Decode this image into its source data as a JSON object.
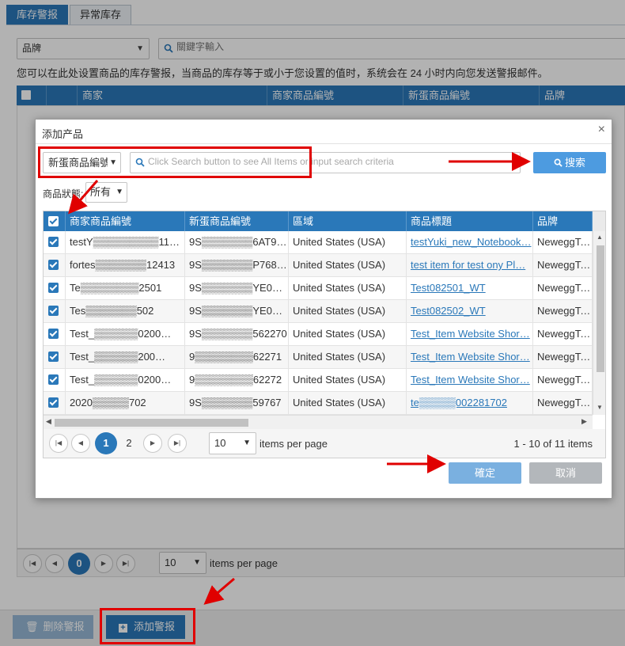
{
  "tabs": [
    {
      "label": "库存警报"
    },
    {
      "label": "异常库存"
    }
  ],
  "filter": {
    "field_value": "品牌",
    "search_placeholder": "關鍵字輸入"
  },
  "description": "您可以在此处设置商品的库存警报，当商品的库存等于或小于您设置的值时，系统会在 24 小时内向您发送警报邮件。",
  "bg_grid": {
    "columns": [
      "",
      "商家",
      "商家商品編號",
      "新蛋商品編號",
      "品牌"
    ]
  },
  "bg_pager": {
    "current_page": "0",
    "per_page": "10",
    "per_page_label": "items per page"
  },
  "footer": {
    "delete_label": "删除警报",
    "add_label": "添加警报"
  },
  "modal": {
    "title": "添加产品",
    "close": "×",
    "search_field": "新蛋商品編號",
    "search_placeholder": "Click Search button to see All Items or input search criteria",
    "search_button": "搜索",
    "status_label": "商品狀態:",
    "status_value": "所有",
    "columns": [
      "商家商品編號",
      "新蛋商品編號",
      "區域",
      "商品標題",
      "品牌"
    ],
    "rows": [
      {
        "seller_item": "testY▒▒▒▒▒▒▒▒▒1102…",
        "newegg_item": "9S▒▒▒▒▒▒▒6AT9779",
        "region": "United States (USA)",
        "title": "testYuki_new_Notebook…",
        "brand": "NeweggTest"
      },
      {
        "seller_item": "fortes▒▒▒▒▒▒▒12413",
        "newegg_item": "9S▒▒▒▒▒▒▒P768994",
        "region": "United States (USA)",
        "title": "test item for test ony Pl…",
        "brand": "NeweggTest"
      },
      {
        "seller_item": "Te▒▒▒▒▒▒▒▒2501",
        "newegg_item": "9S▒▒▒▒▒▒▒YE0592",
        "region": "United States (USA)",
        "title": "Test082501_WT",
        "brand": "NeweggTest"
      },
      {
        "seller_item": "Tes▒▒▒▒▒▒▒502",
        "newegg_item": "9S▒▒▒▒▒▒▒YE0593",
        "region": "United States (USA)",
        "title": "Test082502_WT",
        "brand": "NeweggTest"
      },
      {
        "seller_item": "Test_▒▒▒▒▒▒0200…",
        "newegg_item": "9S▒▒▒▒▒▒▒562270",
        "region": "United States (USA)",
        "title": "Test_Item Website Shor…",
        "brand": "NeweggTest"
      },
      {
        "seller_item": "Test_▒▒▒▒▒▒200…",
        "newegg_item": "9▒▒▒▒▒▒▒▒62271",
        "region": "United States (USA)",
        "title": "Test_Item Website Shor…",
        "brand": "NeweggTest"
      },
      {
        "seller_item": "Test_▒▒▒▒▒▒0200…",
        "newegg_item": "9▒▒▒▒▒▒▒▒62272",
        "region": "United States (USA)",
        "title": "Test_Item Website Shor…",
        "brand": "NeweggTest"
      },
      {
        "seller_item": "2020▒▒▒▒▒702",
        "newegg_item": "9S▒▒▒▒▒▒▒59767",
        "region": "United States (USA)",
        "title": "te▒▒▒▒▒002281702",
        "brand": "NeweggTest"
      }
    ],
    "pager": {
      "page1": "1",
      "page2": "2",
      "per_page": "10",
      "per_page_label": "items per page",
      "summary": "1 - 10 of 11 items"
    },
    "ok_button": "確定",
    "cancel_button": "取消"
  },
  "colors": {
    "header_blue": "#2a78b9",
    "search_button": "#4d9be0",
    "callout_red": "#e00000"
  }
}
